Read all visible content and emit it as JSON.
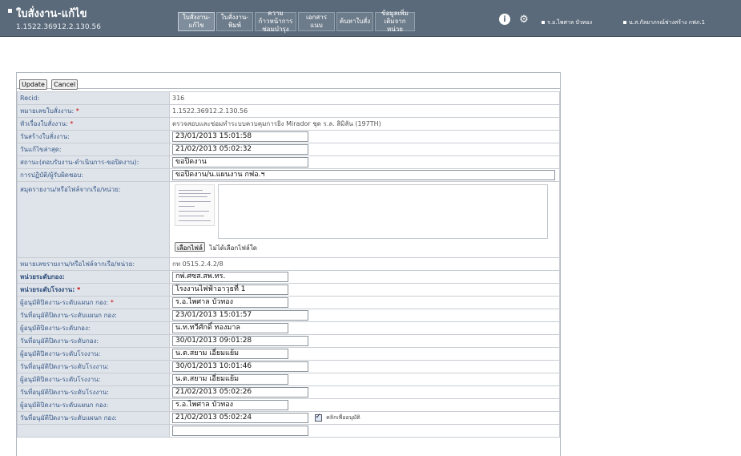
{
  "header": {
    "title": "ใบสั่งงาน-แก้ไข",
    "subtitle": "1.1522.36912.2.130.56",
    "tabs": [
      {
        "label": "ใบสั่งงาน-แก้ไข",
        "active": true
      },
      {
        "label": "ใบสั่งงาน-พิมพ์",
        "active": false
      },
      {
        "label": "ความก้าวหน้าการซ่อมบำรุง",
        "active": false
      },
      {
        "label": "เอกสารแนบ",
        "active": false
      },
      {
        "label": "ค้นหาใบสั่ง",
        "active": false
      },
      {
        "label": "ข้อมูลเพิ่มเติมจากหน่วย",
        "active": false
      }
    ],
    "icons": {
      "info": "info-icon",
      "settings": "gear-icon"
    },
    "user_links": [
      "ร.อ.ไพศาล บัวทอง",
      "น.ส.กัลยาภรณ์ช่างสร้าง กฟภ.1"
    ]
  },
  "toolbar": {
    "update_label": "Update",
    "cancel_label": "Cancel"
  },
  "form": {
    "recid": {
      "label": "Recid:",
      "value": "316"
    },
    "work_number": {
      "label": "หมายเลขใบสั่งงาน:",
      "value": "1.1522.36912.2.130.56"
    },
    "work_subject": {
      "label": "หัวเรื่องใบสั่งงาน:",
      "value": "ตรวจสอบและซ่อมทำระบบควบคุมการยิง Mirador ชุด ร.ล. สิมิลัน (197TH)"
    },
    "created_date": {
      "label": "วันสร้างใบสั่งงาน:",
      "value": "23/01/2013 15:01:58"
    },
    "last_update": {
      "label": "วันแก้ไขล่าสุด:",
      "value": "21/02/2013 05:02:32"
    },
    "status": {
      "label": "สถานะ(ตอบรับงาน-ดำเนินการ-ขอปิดงาน):",
      "value": "ขอปิดงาน"
    },
    "operator": {
      "label": "การปฏิบัติ/ผู้รับผิดชอบ:",
      "value": "ขอปิดงาน/น.แผนงาน กฟอ.ฯ"
    },
    "report_attach": {
      "label": "สมุดรายงาน/หรือไฟล์จากเรือ/หน่วย:",
      "choose_button": "เลือกไฟล์",
      "no_file_text": "ไม่ได้เลือกไฟล์ใด"
    },
    "report_number": {
      "label": "หมายเลขรายงาน/หรือไฟล์จากเรือ/หน่วย:",
      "value": "กท 0515.2.4.2/8"
    },
    "unit_level": {
      "label": "หน่วยระดับกอง:",
      "value": "กพ่.ศซส.สพ.ทร."
    },
    "factory_level": {
      "label": "หน่วยระดับโรงงาน:",
      "value": "โรงงานไฟฟ้าอาวุธที่ 1"
    },
    "close_approver_dept": {
      "label": "ผู้อนุมัติปิดงาน-ระดับแผนก กอง:",
      "value": "ร.อ.ไพศาล บัวทอง"
    },
    "close_date_dept": {
      "label": "วันที่อนุมัติปิดงาน-ระดับแผนก กอง:",
      "value": "23/01/2013 15:01:57"
    },
    "close_approver_div": {
      "label": "ผู้อนุมัติปิดงาน-ระดับกอง:",
      "value": "น.ท.ทวีศักดิ์ ทองมาล"
    },
    "close_date_div": {
      "label": "วันที่อนุมัติปิดงาน-ระดับกอง:",
      "value": "30/01/2013 09:01:28"
    },
    "close_approver_factory": {
      "label": "ผู้อนุมัติปิดงาน-ระดับโรงงาน:",
      "value": "น.ต.สยาม เอี่ยมแย้ม"
    },
    "close_date_factory": {
      "label": "วันที่อนุมัติปิดงาน-ระดับโรงงาน:",
      "value": "30/01/2013 10:01:46"
    },
    "closer_factory": {
      "label": "ผู้อนุมัติปิดงาน-ระดับโรงงาน:",
      "value": "น.ต.สยาม เอี่ยมแย้ม"
    },
    "close_date_factory2": {
      "label": "วันที่อนุมัติปิดงาน-ระดับโรงงาน:",
      "value": "21/02/2013 05:02:26"
    },
    "close_approver_dept2": {
      "label": "ผู้อนุมัติปิดงาน-ระดับแผนก กอง:",
      "value": "ร.อ.ไพศาล บัวทอง"
    },
    "close_date_dept2": {
      "label": "วันที่อนุมัติปิดงาน-ระดับแผนก กอง:",
      "value": "21/02/2013 05:02:24",
      "checkbox_label": "คลิกเพื่ออนุมัติ",
      "checked": true
    }
  },
  "colors": {
    "header_bg": "#5a6a7a",
    "label_bg": "#dfe4ea",
    "label_text": "#3a5a8a",
    "required": "#cc0000"
  }
}
